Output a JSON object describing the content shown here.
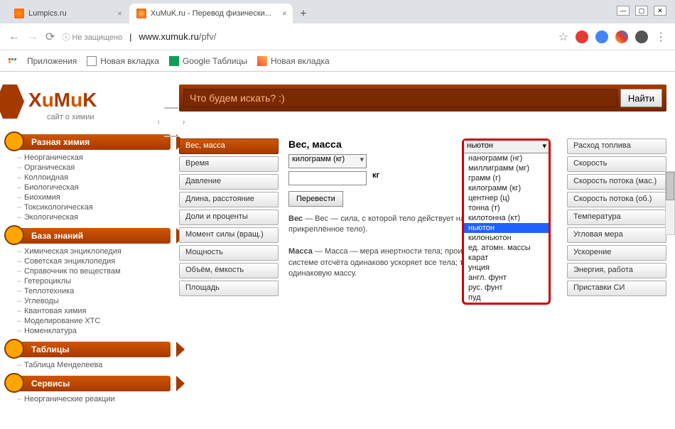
{
  "browser": {
    "tabs": [
      {
        "title": "Lumpics.ru"
      },
      {
        "title": "XuMuK.ru - Перевод физически..."
      }
    ],
    "url_prefix": "Не защищено",
    "url_host": "www.xumuk.ru",
    "url_path": "/pfv/",
    "bookmarks_label": "Приложения",
    "bookmarks": [
      "Новая вкладка",
      "Google Таблицы",
      "Новая вкладка"
    ]
  },
  "logo": {
    "text": "XuMuK",
    "sub": "сайт о химии"
  },
  "search": {
    "placeholder": "Что будем искать? :)",
    "button": "Найти"
  },
  "sidebar": [
    {
      "title": "Разная химия",
      "items": [
        "Неорганическая",
        "Органическая",
        "Коллоидная",
        "Биологическая",
        "Биохимия",
        "Токсикологическая",
        "Экологическая"
      ]
    },
    {
      "title": "База знаний",
      "items": [
        "Химическая энциклопедия",
        "Советская энциклопедия",
        "Справочник по веществам",
        "Гетероциклы",
        "Теплотехника",
        "Углеводы",
        "Квантовая химия",
        "Моделирование ХТС",
        "Номенклатура"
      ]
    },
    {
      "title": "Таблицы",
      "items": [
        "Таблица Менделеева"
      ]
    },
    {
      "title": "Сервисы",
      "items": [
        "Неорганические реакции"
      ]
    }
  ],
  "left_col": [
    "Вес, масса",
    "Время",
    "Давление",
    "Длина, расстояние",
    "Доли и проценты",
    "Момент силы (вращ.)",
    "Мощность",
    "Объём, ёмкость",
    "Площадь"
  ],
  "right_col": [
    "Расход топлива",
    "Скорость",
    "Скорость потока (мас.)",
    "Скорость потока (об.)",
    "Температура",
    "Угловая мера",
    "Ускорение",
    "Энергия, работа",
    "Приставки СИ"
  ],
  "center": {
    "heading": "Вес, масса",
    "from_sel": "килограмм (кг)",
    "suffix": "кг",
    "convert": "Перевести",
    "def1": "Вес — сила, с которой тело действует на опору (или подвес), прикреплённое тело).",
    "def2": "Масса — мера инертности тела; произвольная сила в любой системе отсчёта одинаково ускоряет все тела; телам приписывают одинаковую массу."
  },
  "dropdown": {
    "current": "ньютон",
    "items": [
      "нанограмм (нг)",
      "миллиграмм (мг)",
      "грамм (г)",
      "килограмм (кг)",
      "центнер (ц)",
      "тонна (т)",
      "килотонна (кт)",
      "ньютон",
      "килоньютон",
      "ед. атомн. массы",
      "карат",
      "унция",
      "англ. фунт",
      "рус. фунт",
      "пуд"
    ]
  }
}
